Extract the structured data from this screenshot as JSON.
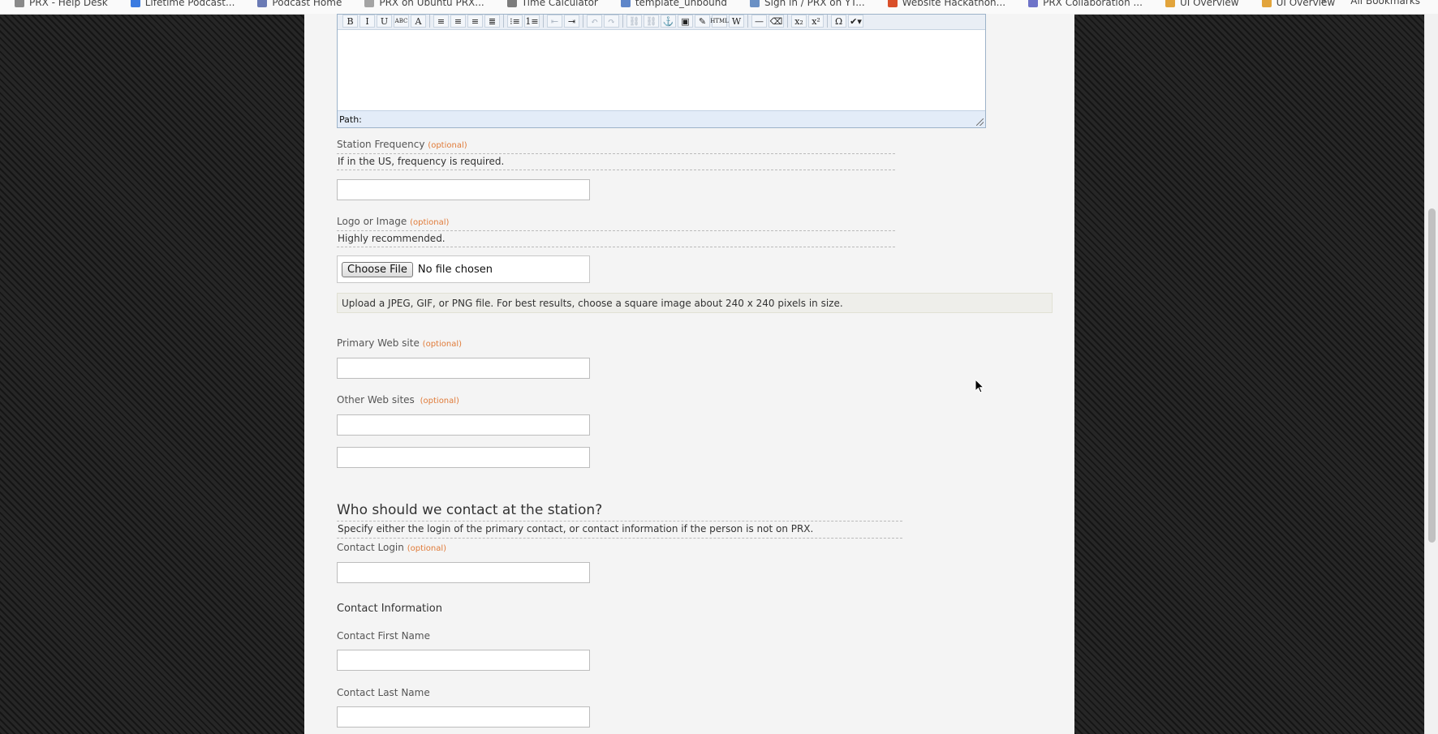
{
  "bookmarks": [
    "PRX - Help Desk",
    "Lifetime Podcast...",
    "Podcast Home",
    "PRX on Ubuntu PRX...",
    "Time Calculator",
    "template_unbound",
    "Sign in / PRX on YT...",
    "Website Hackathon...",
    "PRX Collaboration ...",
    "UI Overview",
    "UI Overview"
  ],
  "bookmark_colors": [
    "#8a8a8a",
    "#3b7be0",
    "#6b7bb5",
    "#a4a4a4",
    "#7c7c7c",
    "#5f86c9",
    "#6a90c4",
    "#d94f2a",
    "#6e73c8",
    "#e2a43b",
    "#e2a43b"
  ],
  "bookmarks_overflow": "»",
  "all_bookmarks": "All Bookmarks",
  "editor": {
    "toolbar": [
      {
        "icon": "bold-icon",
        "glyph": "B"
      },
      {
        "icon": "italic-icon",
        "glyph": "I"
      },
      {
        "icon": "underline-icon",
        "glyph": "U"
      },
      {
        "icon": "strikethrough-icon",
        "glyph": "ABC"
      },
      {
        "icon": "text-color-icon",
        "glyph": "A"
      },
      {
        "sep": true
      },
      {
        "icon": "align-left-icon",
        "glyph": "≡"
      },
      {
        "icon": "align-center-icon",
        "glyph": "≡"
      },
      {
        "icon": "align-right-icon",
        "glyph": "≡"
      },
      {
        "icon": "align-justify-icon",
        "glyph": "≣"
      },
      {
        "sep": true
      },
      {
        "icon": "bullet-list-icon",
        "glyph": "⁝≡"
      },
      {
        "icon": "numbered-list-icon",
        "glyph": "1≡"
      },
      {
        "sep": true
      },
      {
        "icon": "outdent-icon",
        "glyph": "⇤",
        "dim": true
      },
      {
        "icon": "indent-icon",
        "glyph": "⇥"
      },
      {
        "sep": true
      },
      {
        "icon": "undo-icon",
        "glyph": "↶",
        "dim": true
      },
      {
        "icon": "redo-icon",
        "glyph": "↷",
        "dim": true
      },
      {
        "sep": true
      },
      {
        "icon": "link-icon",
        "glyph": "⛓",
        "dim": true
      },
      {
        "icon": "unlink-icon",
        "glyph": "⛓",
        "dim": true
      },
      {
        "icon": "anchor-icon",
        "glyph": "⚓"
      },
      {
        "icon": "image-icon",
        "glyph": "▣"
      },
      {
        "icon": "cleanup-icon",
        "glyph": "✎"
      },
      {
        "icon": "html-source-icon",
        "glyph": "HTML"
      },
      {
        "icon": "paste-word-icon",
        "glyph": "W"
      },
      {
        "sep": true
      },
      {
        "icon": "horizontal-rule-icon",
        "glyph": "—"
      },
      {
        "icon": "remove-format-icon",
        "glyph": "⌫"
      },
      {
        "sep": true
      },
      {
        "icon": "subscript-icon",
        "glyph": "x₂"
      },
      {
        "icon": "superscript-icon",
        "glyph": "x²"
      },
      {
        "sep": true
      },
      {
        "icon": "special-char-icon",
        "glyph": "Ω"
      },
      {
        "icon": "spellcheck-icon",
        "glyph": "✔▾"
      }
    ],
    "path_label": "Path:"
  },
  "form": {
    "station_frequency": {
      "label": "Station Frequency",
      "optional": "(optional)",
      "help": "If in the US, frequency is required.",
      "value": ""
    },
    "logo": {
      "label": "Logo or Image",
      "optional": "(optional)",
      "help": "Highly recommended.",
      "button": "Choose File",
      "status": "No file chosen",
      "note": "Upload a JPEG, GIF, or PNG file. For best results, choose a square image about 240 x 240 pixels in size."
    },
    "primary_web_site": {
      "label": "Primary Web site",
      "optional": "(optional)",
      "value": ""
    },
    "other_web_sites": {
      "label": "Other Web sites",
      "optional": "(optional)",
      "values": [
        "",
        ""
      ]
    },
    "contact_section": {
      "heading": "Who should we contact at the station?",
      "help": "Specify either the login of the primary contact, or contact information if the person is not on PRX."
    },
    "contact_login": {
      "label": "Contact Login",
      "optional": "(optional)",
      "value": ""
    },
    "contact_information": {
      "heading": "Contact Information"
    },
    "contact_first_name": {
      "label": "Contact First Name",
      "value": ""
    },
    "contact_last_name": {
      "label": "Contact Last Name",
      "value": ""
    }
  }
}
